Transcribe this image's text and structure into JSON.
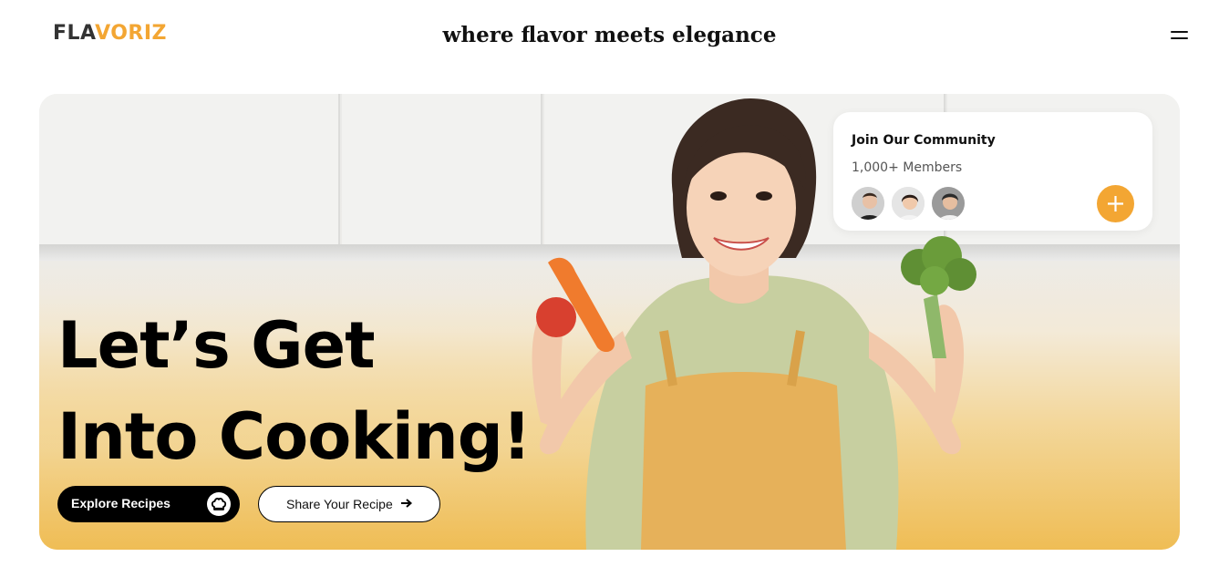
{
  "header": {
    "logo_part1": "FLA",
    "logo_part2": "VORIZ",
    "tagline": "where flavor meets elegance",
    "menu_icon": "hamburger-menu-icon"
  },
  "hero": {
    "headline_line1": "Let’s Get",
    "headline_line2": "Into Cooking!",
    "explore_button": "Explore Recipes",
    "explore_icon": "chef-hat-icon",
    "share_button": "Share Your Recipe",
    "share_icon": "arrow-right-icon",
    "image": "woman-holding-vegetables-photo"
  },
  "community": {
    "title": "Join Our Community",
    "members": "1,000+ Members",
    "avatars": [
      "member-avatar-1",
      "member-avatar-2",
      "member-avatar-3"
    ],
    "add_icon": "plus-icon"
  },
  "colors": {
    "accent": "#f3a633",
    "hero_gradient_bottom": "#efbd55",
    "text": "#000000"
  }
}
